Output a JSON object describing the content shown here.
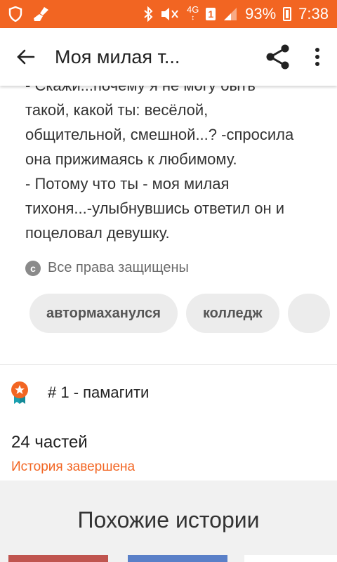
{
  "statusbar": {
    "battery": "93%",
    "time": "7:38",
    "network": "4G",
    "sim": "1"
  },
  "toolbar": {
    "title": "Моя милая т..."
  },
  "story": {
    "paragraph_cut": "- Скажи...почему я не могу быть",
    "paragraph": "такой, какой ты: весёлой,\nобщительной, смешной...? -спросила\nона прижимаясь к любимому.\n- Потому что ты - моя милая\nтихоня...-улыбнувшись ответил он и\nпоцеловал девушку."
  },
  "copyright": {
    "symbol": "c",
    "text": "Все права защищены"
  },
  "tags": [
    {
      "label": "автормаханулся"
    },
    {
      "label": "колледж"
    },
    {
      "label": ""
    }
  ],
  "rank": {
    "label": "# 1 - памагити"
  },
  "parts": {
    "count_label": "24 частей",
    "status": "История завершена"
  },
  "similar": {
    "title": "Похожие истории"
  },
  "colors": {
    "accent": "#f26522",
    "tag_bg": "#ececec"
  }
}
